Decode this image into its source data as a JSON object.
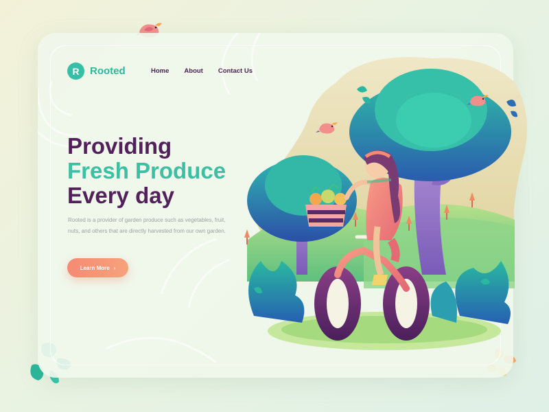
{
  "brand": {
    "logo_letter": "R",
    "name": "Rooted"
  },
  "nav": {
    "items": [
      {
        "label": "Home"
      },
      {
        "label": "About"
      },
      {
        "label": "Contact Us"
      }
    ]
  },
  "hero": {
    "title_line1": "Providing",
    "title_line2": "Fresh Produce",
    "title_line3": "Every day",
    "description": "Rooted is a provider of garden produce such as vegetables, fruit, nuts, and others that are directly harvested from our own garden.",
    "cta_label": "Learn More",
    "cta_icon": "chevron-right-icon"
  },
  "colors": {
    "brand_teal": "#35c0a5",
    "title_purple": "#52205a",
    "cta_coral": "#f58a73",
    "background": "#eef5e6"
  },
  "illustration": {
    "subject": "girl-riding-bicycle-icon",
    "elements": [
      "tree-icon",
      "bush-icon",
      "bird-icon",
      "fruit-basket-icon"
    ]
  }
}
